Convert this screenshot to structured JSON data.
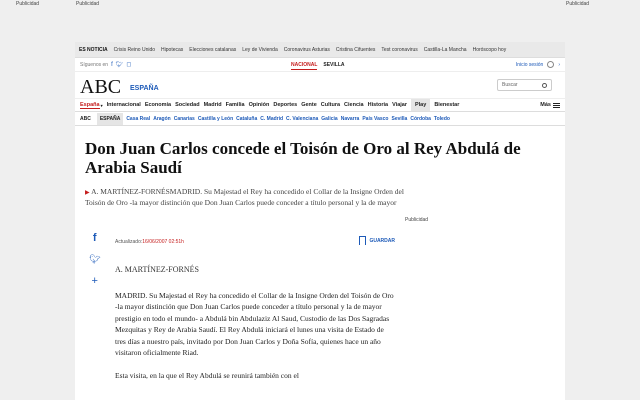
{
  "ads": {
    "left1": "Publicidad",
    "left2": "Publicidad",
    "right": "Publicidad"
  },
  "topbar": {
    "label": "ES NOTICIA",
    "items": [
      "Crisis Reino Unido",
      "Hipotecas",
      "Elecciones catalanas",
      "Ley de Vivienda",
      "Coronavirus Asturias",
      "Cristina Cifuentes",
      "Test coronavirus",
      "Castilla-La Mancha",
      "Horóscopo hoy"
    ]
  },
  "sharebar": {
    "follow": "Síguenos en",
    "sections": [
      "NACIONAL",
      "SEVILLA"
    ],
    "login": "Inicio sesión"
  },
  "logo": {
    "name": "ABC",
    "edition": "ESPAÑA"
  },
  "search": {
    "placeholder": "Buscar"
  },
  "nav": {
    "items": [
      "España",
      "Internacional",
      "Economía",
      "Sociedad",
      "Madrid",
      "Familia",
      "Opinión",
      "Deportes",
      "Gente",
      "Cultura",
      "Ciencia",
      "Historia",
      "Viajar"
    ],
    "play": "Play",
    "bienestar": "Bienestar",
    "more": "Más"
  },
  "subnav": {
    "tags": [
      "ABC",
      "ESPAÑA"
    ],
    "regions": [
      "Casa Real",
      "Aragón",
      "Canarias",
      "Castilla y León",
      "Cataluña",
      "C. Madrid",
      "C. Valenciana",
      "Galicia",
      "Navarra",
      "País Vasco",
      "Sevilla",
      "Córdoba",
      "Toledo"
    ]
  },
  "article": {
    "headline": "Don Juan Carlos concede el Toisón de Oro al Rey Abdulá de Arabia Saudí",
    "lead": "A. MARTÍNEZ-FORNÉSMADRID. Su Majestad el Rey ha concedido el Collar de la Insigne Orden del Toisón de Oro -la mayor distinción que Don Juan Carlos puede conceder a título personal y la de mayor",
    "side_ad": "Publicidad",
    "updated_label": "Actualizado:",
    "updated_date": "16/06/2007 02:51h",
    "save": "GUARDAR",
    "author": "A. MARTÍNEZ-FORNÉS",
    "paragraphs": [
      "MADRID. Su Majestad el Rey ha concedido el Collar de la Insigne Orden del Toisón de Oro -la mayor distinción que Don Juan Carlos puede conceder a título personal y la de mayor prestigio en todo el mundo- a Abdulá bin Abdulaziz Al Saud, Custodio de las Dos Sagradas Mezquitas y Rey de Arabia Saudí. El Rey Abdulá iniciará el lunes una visita de Estado de tres días a nuestro país, invitado por Don Juan Carlos y Doña Sofía, quienes hace un año visitaron oficialmente Riad.",
      "Esta visita, en la que el Rey Abdulá se reunirá también con el"
    ]
  },
  "colors": {
    "accent_red": "#c51d1d",
    "link_blue": "#1d5ab8"
  }
}
